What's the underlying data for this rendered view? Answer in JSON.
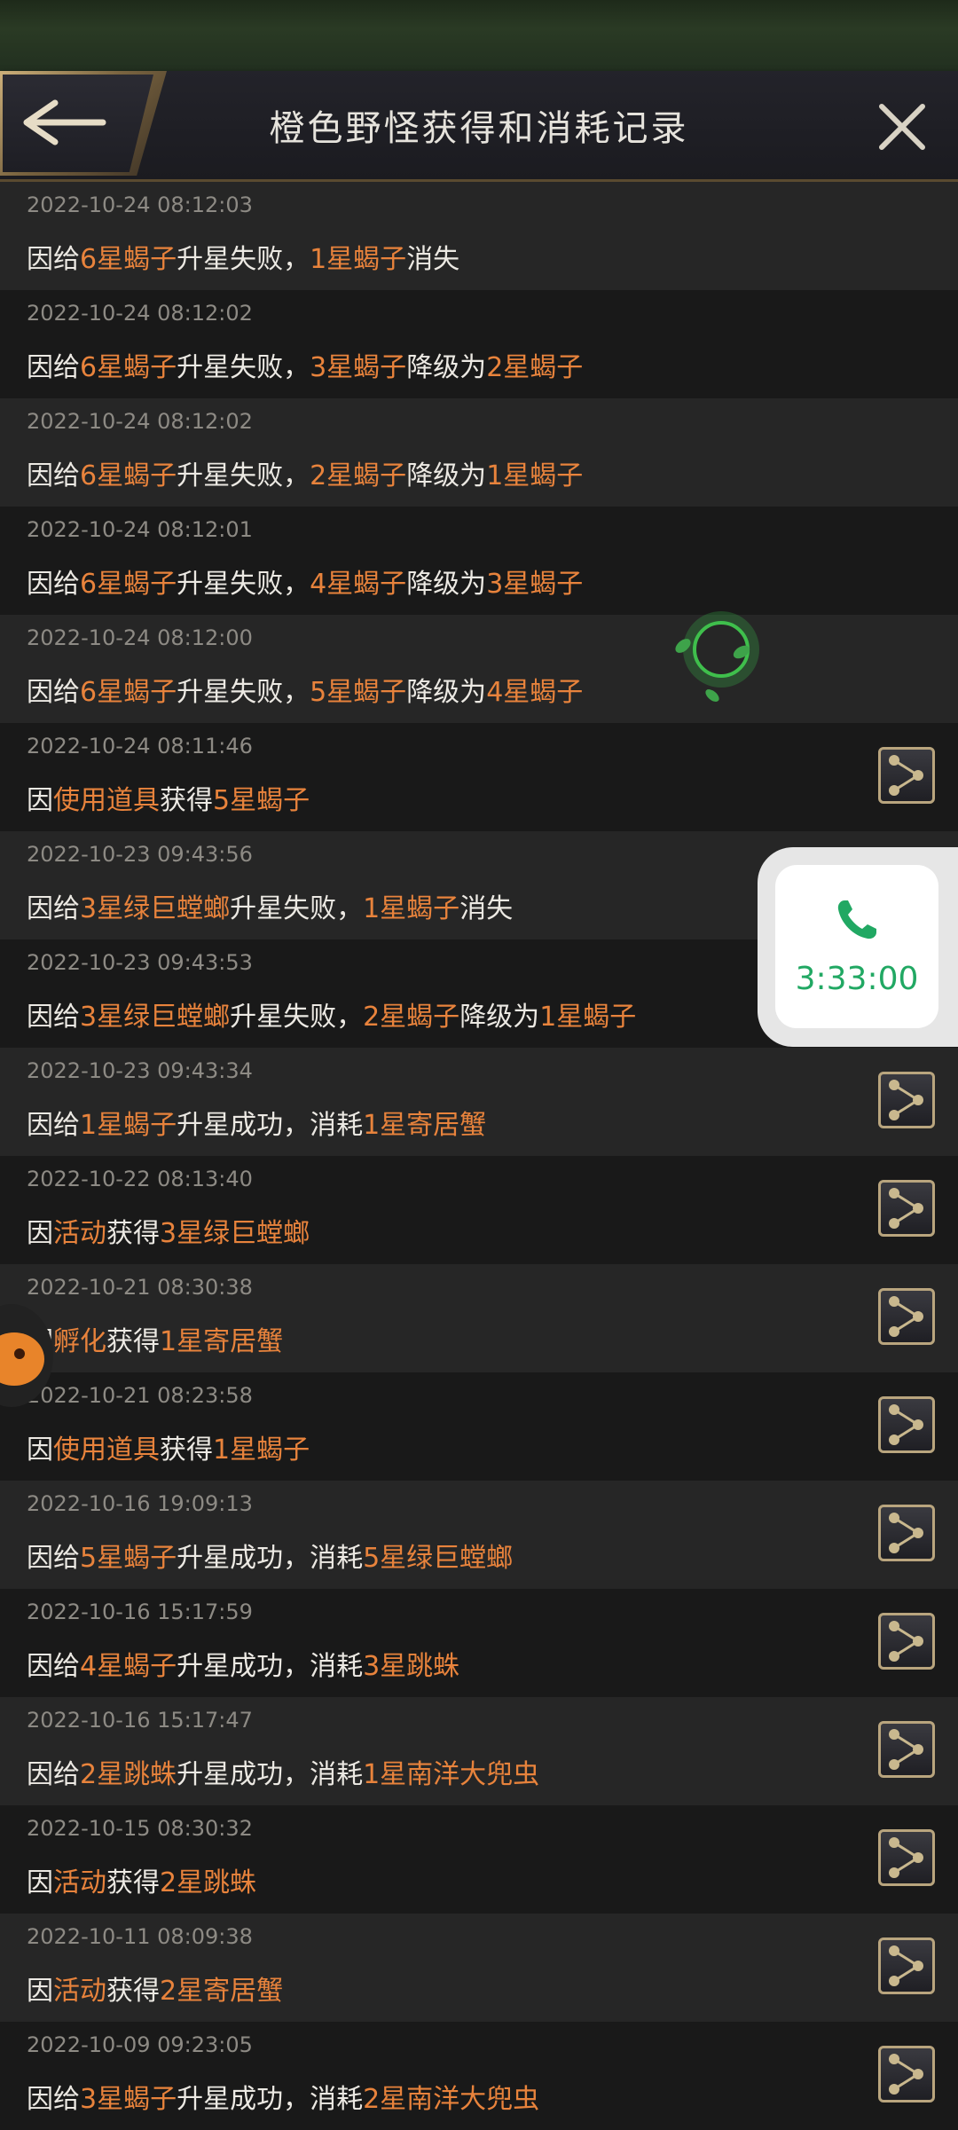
{
  "header": {
    "title": "橙色野怪获得和消耗记录"
  },
  "call": {
    "time": "3:33:00"
  },
  "records": [
    {
      "time": "2022-10-24 08:12:03",
      "share": false,
      "segments": [
        {
          "t": "因给"
        },
        {
          "t": "6星蝎子",
          "h": true
        },
        {
          "t": "升星失败，"
        },
        {
          "t": "1星蝎子",
          "h": true
        },
        {
          "t": "消失"
        }
      ]
    },
    {
      "time": "2022-10-24 08:12:02",
      "share": false,
      "segments": [
        {
          "t": "因给"
        },
        {
          "t": "6星蝎子",
          "h": true
        },
        {
          "t": "升星失败，"
        },
        {
          "t": "3星蝎子",
          "h": true
        },
        {
          "t": "降级为"
        },
        {
          "t": "2星蝎子",
          "h": true
        }
      ]
    },
    {
      "time": "2022-10-24 08:12:02",
      "share": false,
      "segments": [
        {
          "t": "因给"
        },
        {
          "t": "6星蝎子",
          "h": true
        },
        {
          "t": "升星失败，"
        },
        {
          "t": "2星蝎子",
          "h": true
        },
        {
          "t": "降级为"
        },
        {
          "t": "1星蝎子",
          "h": true
        }
      ]
    },
    {
      "time": "2022-10-24 08:12:01",
      "share": false,
      "segments": [
        {
          "t": "因给"
        },
        {
          "t": "6星蝎子",
          "h": true
        },
        {
          "t": "升星失败，"
        },
        {
          "t": "4星蝎子",
          "h": true
        },
        {
          "t": "降级为"
        },
        {
          "t": "3星蝎子",
          "h": true
        }
      ]
    },
    {
      "time": "2022-10-24 08:12:00",
      "share": false,
      "segments": [
        {
          "t": "因给"
        },
        {
          "t": "6星蝎子",
          "h": true
        },
        {
          "t": "升星失败，"
        },
        {
          "t": "5星蝎子",
          "h": true
        },
        {
          "t": "降级为"
        },
        {
          "t": "4星蝎子",
          "h": true
        }
      ]
    },
    {
      "time": "2022-10-24 08:11:46",
      "share": true,
      "segments": [
        {
          "t": "因"
        },
        {
          "t": "使用道具",
          "h": true
        },
        {
          "t": "获得"
        },
        {
          "t": "5星蝎子",
          "h": true
        }
      ]
    },
    {
      "time": "2022-10-23 09:43:56",
      "share": false,
      "segments": [
        {
          "t": "因给"
        },
        {
          "t": "3星绿巨螳螂",
          "h": true
        },
        {
          "t": "升星失败，"
        },
        {
          "t": "1星蝎子",
          "h": true
        },
        {
          "t": "消失"
        }
      ]
    },
    {
      "time": "2022-10-23 09:43:53",
      "share": false,
      "segments": [
        {
          "t": "因给"
        },
        {
          "t": "3星绿巨螳螂",
          "h": true
        },
        {
          "t": "升星失败，"
        },
        {
          "t": "2星蝎子",
          "h": true
        },
        {
          "t": "降级为"
        },
        {
          "t": "1星蝎子",
          "h": true
        }
      ]
    },
    {
      "time": "2022-10-23 09:43:34",
      "share": true,
      "segments": [
        {
          "t": "因给"
        },
        {
          "t": "1星蝎子",
          "h": true
        },
        {
          "t": "升星成功，消耗"
        },
        {
          "t": "1星寄居蟹",
          "h": true
        }
      ]
    },
    {
      "time": "2022-10-22 08:13:40",
      "share": true,
      "segments": [
        {
          "t": "因"
        },
        {
          "t": "活动",
          "h": true
        },
        {
          "t": "获得"
        },
        {
          "t": "3星绿巨螳螂",
          "h": true
        }
      ]
    },
    {
      "time": "2022-10-21 08:30:38",
      "share": true,
      "segments": [
        {
          "t": "因"
        },
        {
          "t": "孵化",
          "h": true
        },
        {
          "t": "获得"
        },
        {
          "t": "1星寄居蟹",
          "h": true
        }
      ]
    },
    {
      "time": "2022-10-21 08:23:58",
      "share": true,
      "segments": [
        {
          "t": "因"
        },
        {
          "t": "使用道具",
          "h": true
        },
        {
          "t": "获得"
        },
        {
          "t": "1星蝎子",
          "h": true
        }
      ]
    },
    {
      "time": "2022-10-16 19:09:13",
      "share": true,
      "segments": [
        {
          "t": "因给"
        },
        {
          "t": "5星蝎子",
          "h": true
        },
        {
          "t": "升星成功，消耗"
        },
        {
          "t": "5星绿巨螳螂",
          "h": true
        }
      ]
    },
    {
      "time": "2022-10-16 15:17:59",
      "share": true,
      "segments": [
        {
          "t": "因给"
        },
        {
          "t": "4星蝎子",
          "h": true
        },
        {
          "t": "升星成功，消耗"
        },
        {
          "t": "3星跳蛛",
          "h": true
        }
      ]
    },
    {
      "time": "2022-10-16 15:17:47",
      "share": true,
      "segments": [
        {
          "t": "因给"
        },
        {
          "t": "2星跳蛛",
          "h": true
        },
        {
          "t": "升星成功，消耗"
        },
        {
          "t": "1星南洋大兜虫",
          "h": true
        }
      ]
    },
    {
      "time": "2022-10-15 08:30:32",
      "share": true,
      "segments": [
        {
          "t": "因"
        },
        {
          "t": "活动",
          "h": true
        },
        {
          "t": "获得"
        },
        {
          "t": "2星跳蛛",
          "h": true
        }
      ]
    },
    {
      "time": "2022-10-11 08:09:38",
      "share": true,
      "segments": [
        {
          "t": "因"
        },
        {
          "t": "活动",
          "h": true
        },
        {
          "t": "获得"
        },
        {
          "t": "2星寄居蟹",
          "h": true
        }
      ]
    },
    {
      "time": "2022-10-09 09:23:05",
      "share": true,
      "segments": [
        {
          "t": "因给"
        },
        {
          "t": "3星蝎子",
          "h": true
        },
        {
          "t": "升星成功，消耗"
        },
        {
          "t": "2星南洋大兜虫",
          "h": true
        }
      ]
    }
  ]
}
